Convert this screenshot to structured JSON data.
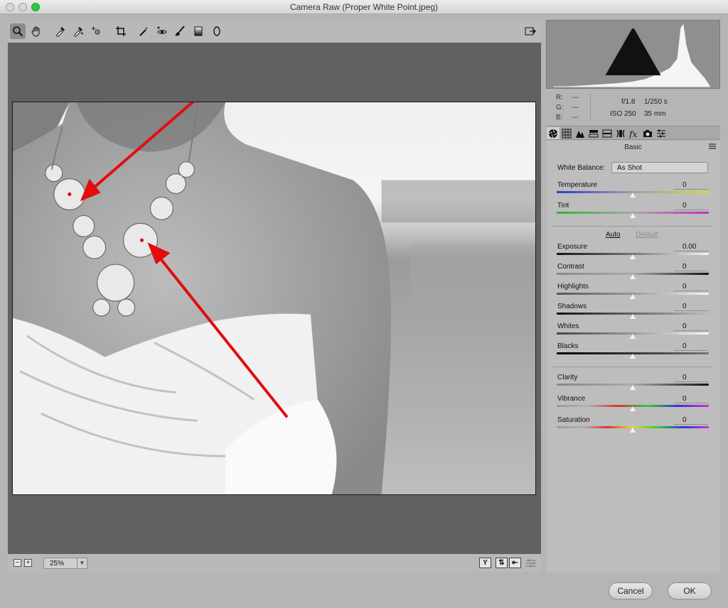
{
  "window": {
    "title": "Camera Raw (Proper White Point.jpeg)"
  },
  "toolbar": {
    "tools": [
      "zoom-icon",
      "hand-icon",
      "white-balance-icon",
      "color-sampler-icon",
      "targeted-adjustment-icon",
      "crop-icon",
      "spot-removal-icon",
      "red-eye-icon",
      "adjustment-brush-icon",
      "graduated-filter-icon",
      "radial-filter-icon"
    ],
    "active_tool": "zoom-icon"
  },
  "preview": {
    "zoom_value": "25%"
  },
  "readout": {
    "r_label": "R:",
    "g_label": "G:",
    "b_label": "B:",
    "r_value": "---",
    "g_value": "---",
    "b_value": "---",
    "aperture": "f/1.8",
    "shutter": "1/250 s",
    "iso": "ISO 250",
    "focal": "35 mm"
  },
  "panel": {
    "title": "Basic",
    "white_balance_label": "White Balance:",
    "white_balance_value": "As Shot",
    "auto_label": "Auto",
    "default_label": "Default",
    "sliders": [
      {
        "name": "Temperature",
        "value": "0",
        "level": 0.5
      },
      {
        "name": "Tint",
        "value": "0",
        "level": 0.5
      },
      {
        "name": "Exposure",
        "value": "0.00",
        "level": 0.5
      },
      {
        "name": "Contrast",
        "value": "0",
        "level": 0.5
      },
      {
        "name": "Highlights",
        "value": "0",
        "level": 0.5
      },
      {
        "name": "Shadows",
        "value": "0",
        "level": 0.5
      },
      {
        "name": "Whites",
        "value": "0",
        "level": 0.5
      },
      {
        "name": "Blacks",
        "value": "0",
        "level": 0.5
      },
      {
        "name": "Clarity",
        "value": "0",
        "level": 0.5
      },
      {
        "name": "Vibrance",
        "value": "0",
        "level": 0.5
      },
      {
        "name": "Saturation",
        "value": "0",
        "level": 0.5
      }
    ]
  },
  "buttons": {
    "cancel": "Cancel",
    "ok": "OK"
  },
  "colors": {
    "annotation_arrow": "#e30d0d",
    "preview_bg": "#616161",
    "panel_bg": "#bdbdbd"
  }
}
